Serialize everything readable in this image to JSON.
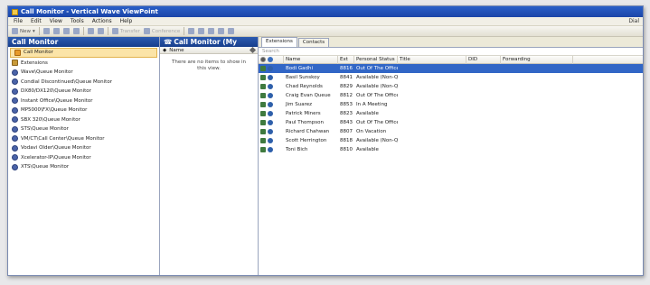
{
  "window": {
    "title": "Call Monitor - Vertical Wave ViewPoint"
  },
  "menu": {
    "items": [
      "File",
      "Edit",
      "View",
      "Tools",
      "Actions",
      "Help"
    ],
    "dial": "Dial"
  },
  "toolbar": {
    "new_label": "New",
    "transfer_label": "Transfer",
    "conference_label": "Conference"
  },
  "left": {
    "header": "Call Monitor",
    "items": [
      {
        "label": "Call Monitor",
        "icon": "call-monitor-icon",
        "selected": true
      },
      {
        "label": "Extensions",
        "icon": "extensions-icon"
      },
      {
        "label": "Wave\\Queue Monitor",
        "icon": "queue-icon"
      },
      {
        "label": "Condial Discontinued\\Queue Monitor",
        "icon": "queue-icon"
      },
      {
        "label": "DX80/DX120\\Queue Monitor",
        "icon": "queue-icon"
      },
      {
        "label": "Instant Office\\Queue Monitor",
        "icon": "queue-icon"
      },
      {
        "label": "MP5000\\FX\\Queue Monitor",
        "icon": "queue-icon"
      },
      {
        "label": "SBX 320\\Queue Monitor",
        "icon": "queue-icon"
      },
      {
        "label": "STS\\Queue Monitor",
        "icon": "queue-icon"
      },
      {
        "label": "VM/CT\\Call Center\\Queue Monitor",
        "icon": "queue-icon"
      },
      {
        "label": "Vodavi Older\\Queue Monitor",
        "icon": "queue-icon"
      },
      {
        "label": "Xcelerator-IP\\Queue Monitor",
        "icon": "queue-icon"
      },
      {
        "label": "XTS\\Queue Monitor",
        "icon": "queue-icon"
      }
    ]
  },
  "middle": {
    "header": "Call Monitor (My",
    "column": "Name",
    "empty": "There are no items to show in this view."
  },
  "right": {
    "tabs": [
      "Extensions",
      "Contacts"
    ],
    "search_placeholder": "Search",
    "columns": {
      "name": "Name",
      "ext": "Ext",
      "status": "Personal Status ...",
      "title": "Title",
      "did": "DID",
      "forwarding": "Forwarding"
    },
    "rows": [
      {
        "name": "Bodi Gadhi",
        "ext": "8816",
        "status": "Out Of The Office",
        "selected": true
      },
      {
        "name": "Basil Sunskoy",
        "ext": "8841",
        "status": "Available (Non-Q..."
      },
      {
        "name": "Chad Reynolds",
        "ext": "8829",
        "status": "Available (Non-Q..."
      },
      {
        "name": "Craig Evan Queue",
        "ext": "8812",
        "status": "Out Of The Office"
      },
      {
        "name": "Jim Suarez",
        "ext": "8853",
        "status": "In A Meeting"
      },
      {
        "name": "Patrick Miners",
        "ext": "8823",
        "status": "Available"
      },
      {
        "name": "Paul Thompson",
        "ext": "8843",
        "status": "Out Of The Office"
      },
      {
        "name": "Richard Chahwan",
        "ext": "8807",
        "status": "On Vacation"
      },
      {
        "name": "Scott Herrington",
        "ext": "8818",
        "status": "Available (Non-Q..."
      },
      {
        "name": "Toni Bich",
        "ext": "8810",
        "status": "Available"
      }
    ]
  }
}
